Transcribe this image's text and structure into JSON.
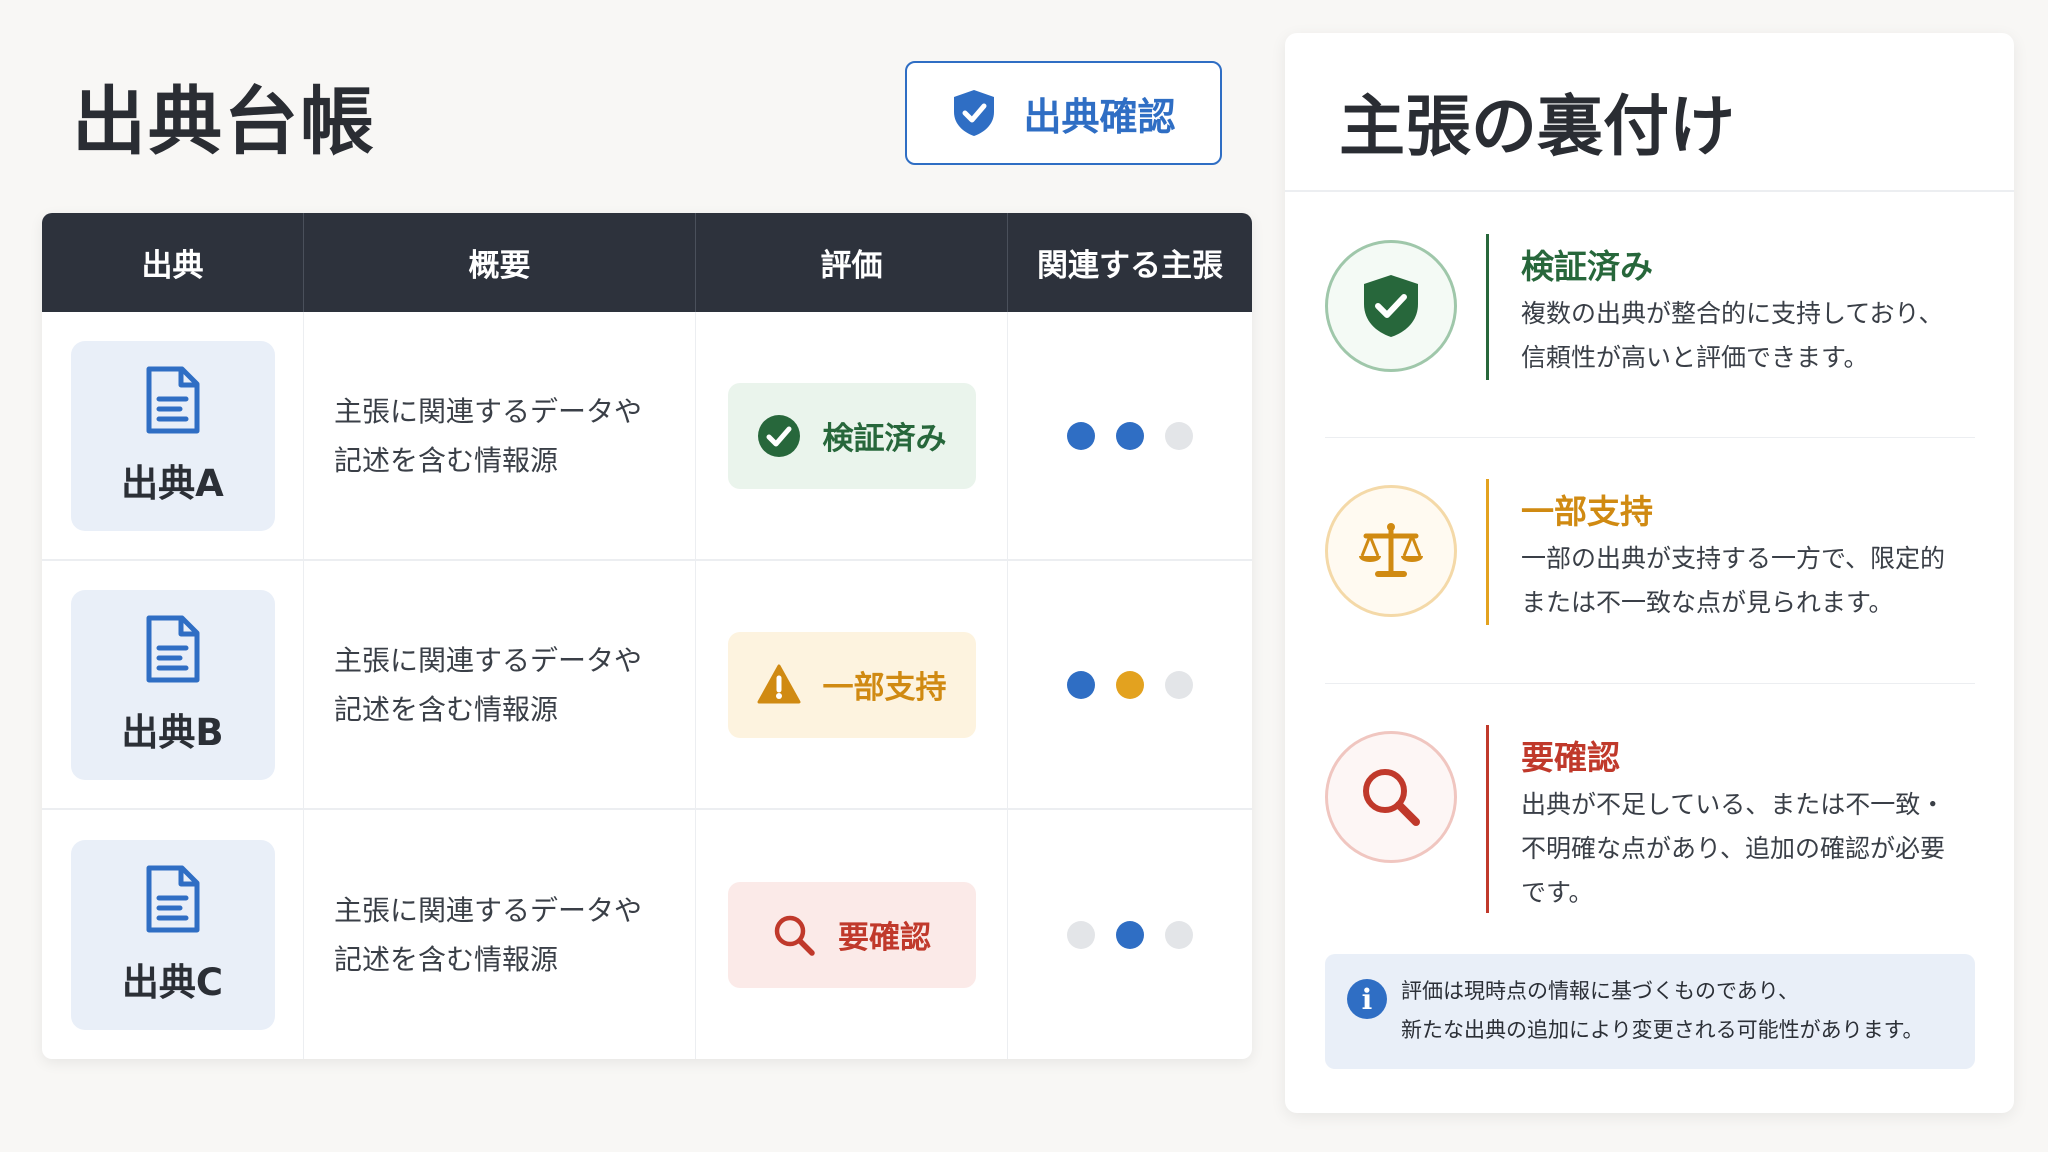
{
  "header": {
    "title": "出典台帳",
    "verify_button": "出典確認"
  },
  "colors": {
    "accent_blue": "#2f6ec4",
    "header_dark": "#2d323c",
    "verified_green": "#27673b",
    "partial_amber": "#d08a12",
    "review_red": "#c0392b",
    "dot_empty": "#e3e5e8"
  },
  "table": {
    "columns": [
      "出典",
      "概要",
      "評価",
      "関連する主張"
    ],
    "rows": [
      {
        "source": "出典A",
        "summary": "主張に関連するデータや\n記述を含む情報源",
        "evaluation": "検証済み",
        "status": "verified",
        "dots": [
          "blue",
          "blue",
          "empty"
        ]
      },
      {
        "source": "出典B",
        "summary": "主張に関連するデータや\n記述を含む情報源",
        "evaluation": "一部支持",
        "status": "partial",
        "dots": [
          "blue",
          "amber",
          "empty"
        ]
      },
      {
        "source": "出典C",
        "summary": "主張に関連するデータや\n記述を含む情報源",
        "evaluation": "要確認",
        "status": "review",
        "dots": [
          "empty",
          "blue",
          "empty"
        ]
      }
    ]
  },
  "panel": {
    "title": "主張の裏付け",
    "legend": [
      {
        "label": "検証済み",
        "icon": "shield-check-icon",
        "description": "複数の出典が整合的に支持しており、\n信頼性が高いと評価できます。"
      },
      {
        "label": "一部支持",
        "icon": "scale-icon",
        "description": "一部の出典が支持する一方で、限定的\nまたは不一致な点が見られます。"
      },
      {
        "label": "要確認",
        "icon": "magnifier-icon",
        "description": "出典が不足している、または不一致・\n不明確な点があり、追加の確認が必要\nです。"
      }
    ],
    "note": "評価は現時点の情報に基づくものであり、\n新たな出典の追加により変更される可能性があります。"
  }
}
